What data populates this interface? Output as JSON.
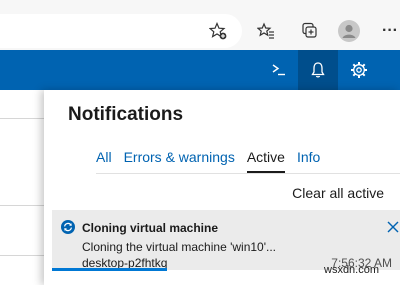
{
  "browser": {
    "icons": [
      "favorite-add-icon",
      "favorites-icon",
      "collections-icon",
      "profile-icon",
      "more-icon"
    ],
    "more_label": "···"
  },
  "header": {
    "icons": [
      "cloud-shell-icon",
      "notifications-icon",
      "settings-icon"
    ],
    "colors": {
      "bar": "#0063b1",
      "active": "#004e8c"
    }
  },
  "notifications": {
    "title": "Notifications",
    "tabs": [
      {
        "label": "All",
        "active": false
      },
      {
        "label": "Errors & warnings",
        "active": false
      },
      {
        "label": "Active",
        "active": true
      },
      {
        "label": "Info",
        "active": false
      }
    ],
    "clear_all": "Clear all active",
    "items": [
      {
        "icon": "sync-icon",
        "title": "Cloning virtual machine",
        "message": "Cloning the virtual machine 'win10'...",
        "source": "desktop-p2fhtkq",
        "time": "7:56:32 AM",
        "progress": 0.33
      }
    ]
  },
  "watermark": "wsxdn.com"
}
